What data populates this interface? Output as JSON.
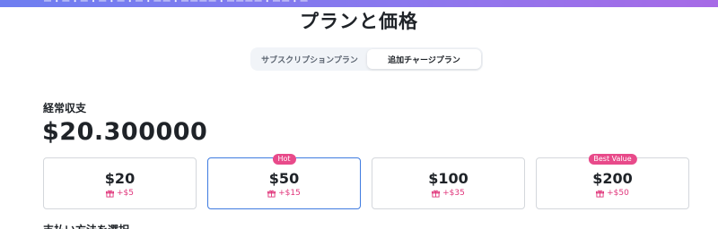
{
  "banner": {
    "text": "ー・ー・ー・ー・ー・ー・ーー・ーーーー・ーーーー・ーー・ー"
  },
  "page": {
    "title": "プランと価格"
  },
  "tabs": [
    {
      "label": "サブスクリプションプラン",
      "active": false
    },
    {
      "label": "追加チャージプラン",
      "active": true
    }
  ],
  "balance": {
    "label": "経常収支",
    "amount": "$20.300000"
  },
  "plans": [
    {
      "price": "$20",
      "bonus": "+$5",
      "badge": "",
      "selected": false
    },
    {
      "price": "$50",
      "bonus": "+$15",
      "badge": "Hot",
      "selected": true
    },
    {
      "price": "$100",
      "bonus": "+$35",
      "badge": "",
      "selected": false
    },
    {
      "price": "$200",
      "bonus": "+$50",
      "badge": "Best Value",
      "selected": false
    }
  ],
  "payment": {
    "label": "支払い方法を選択"
  },
  "colors": {
    "accent": "#3f7be0",
    "badge": "#e84a8a",
    "bonus": "#e0357b"
  },
  "icons": {
    "bonus": "gift-icon"
  }
}
